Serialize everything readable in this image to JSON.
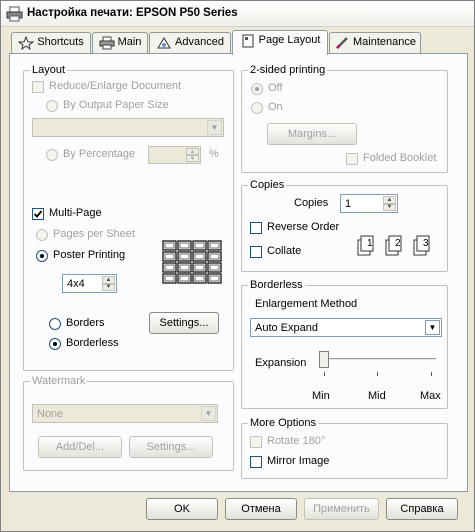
{
  "window": {
    "title": "Настройка печати: EPSON P50 Series"
  },
  "tabs": [
    {
      "label": "Shortcuts",
      "icon": "star-icon"
    },
    {
      "label": "Main",
      "icon": "printer-icon"
    },
    {
      "label": "Advanced",
      "icon": "advanced-icon"
    },
    {
      "label": "Page Layout",
      "icon": "page-icon"
    },
    {
      "label": "Maintenance",
      "icon": "pencil-icon"
    }
  ],
  "active_tab": "Page Layout",
  "layout": {
    "title": "Layout",
    "reduce_enlarge": "Reduce/Enlarge Document",
    "by_output_paper": "By Output Paper Size",
    "output_paper_value": "",
    "by_percentage": "By Percentage",
    "percentage_value": "",
    "percent_sign": "%",
    "multi_page": "Multi-Page",
    "pages_per_sheet": "Pages per Sheet",
    "poster_printing": "Poster Printing",
    "poster_size": "4x4",
    "borders": "Borders",
    "borderless": "Borderless",
    "settings_button": "Settings..."
  },
  "two_sided": {
    "title": "2-sided printing",
    "off": "Off",
    "on": "On",
    "margins_button": "Margins...",
    "folded_booklet": "Folded Booklet"
  },
  "copies": {
    "title": "Copies",
    "copies_label": "Copies",
    "copies_value": "1",
    "reverse_order": "Reverse Order",
    "collate": "Collate",
    "collate_icons": [
      "1",
      "2",
      "3"
    ]
  },
  "borderless": {
    "title": "Borderless",
    "enlargement_label": "Enlargement Method",
    "enlargement_value": "Auto Expand",
    "expansion_label": "Expansion",
    "expansion_level": 0,
    "scale_min": "Min",
    "scale_mid": "Mid",
    "scale_max": "Max"
  },
  "watermark": {
    "title": "Watermark",
    "value": "None",
    "add_del_button": "Add/Del...",
    "settings_button": "Settings..."
  },
  "more_options": {
    "title": "More Options",
    "rotate": "Rotate 180°",
    "mirror": "Mirror Image"
  },
  "footer": {
    "ok": "OK",
    "cancel": "Отмена",
    "apply": "Применить",
    "help": "Справка"
  },
  "colors": {
    "window_bg": "#ece9d8",
    "panel_bg": "#fcfcfe",
    "disabled_text": "#a0a0a0"
  }
}
